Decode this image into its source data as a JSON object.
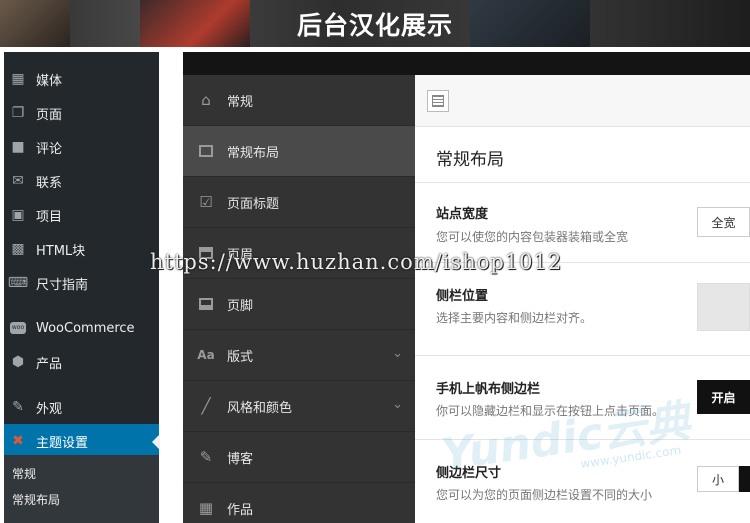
{
  "banner": {
    "title": "后台汉化展示"
  },
  "wp_menu": [
    {
      "label": "媒体",
      "icon": "media-icon"
    },
    {
      "label": "页面",
      "icon": "pages-icon"
    },
    {
      "label": "评论",
      "icon": "comments-icon"
    },
    {
      "label": "联系",
      "icon": "mail-icon"
    },
    {
      "label": "项目",
      "icon": "portfolio-icon"
    },
    {
      "label": "HTML块",
      "icon": "html-block-icon"
    },
    {
      "label": "尺寸指南",
      "icon": "size-guide-icon"
    },
    {
      "label": "WooCommerce",
      "icon": "woocommerce-icon"
    },
    {
      "label": "产品",
      "icon": "products-icon"
    },
    {
      "label": "外观",
      "icon": "appearance-icon"
    },
    {
      "label": "主题设置",
      "icon": "theme-settings-icon",
      "active": true
    }
  ],
  "wp_submenu": [
    "常规",
    "常规布局"
  ],
  "settings_nav": [
    {
      "label": "常规",
      "icon": "home-icon"
    },
    {
      "label": "常规布局",
      "icon": "layout-icon",
      "active": true
    },
    {
      "label": "页面标题",
      "icon": "checkbox-icon"
    },
    {
      "label": "页眉",
      "icon": "header-icon"
    },
    {
      "label": "页脚",
      "icon": "footer-icon"
    },
    {
      "label": "版式",
      "icon": "typography-icon",
      "has_children": true
    },
    {
      "label": "风格和颜色",
      "icon": "brush-icon",
      "has_children": true
    },
    {
      "label": "博客",
      "icon": "pencil-icon"
    },
    {
      "label": "作品",
      "icon": "grid-icon"
    }
  ],
  "main": {
    "section_title": "常规布局",
    "settings": [
      {
        "label": "站点宽度",
        "desc": "您可以使您的内容包装器装箱或全宽",
        "control": "全宽"
      },
      {
        "label": "侧栏位置",
        "desc": "选择主要内容和侧边栏对齐。",
        "control": ""
      },
      {
        "label": "手机上帆布侧边栏",
        "desc": "你可以隐藏边栏和显示在按钮上点击页面。",
        "control": "开启"
      },
      {
        "label": "侧边栏尺寸",
        "desc": "您可以为您的页面侧边栏设置不同的大小",
        "control": "小"
      }
    ]
  },
  "watermarks": {
    "url": "https://www.huzhan.com/ishop1012",
    "brand": "Yundic云典",
    "brand_url": "www.yundic.com"
  },
  "colors": {
    "wp_sidebar": "#23282d",
    "wp_active": "#0073aa",
    "settings_nav": "#333333",
    "toggle_on": "#111111"
  }
}
